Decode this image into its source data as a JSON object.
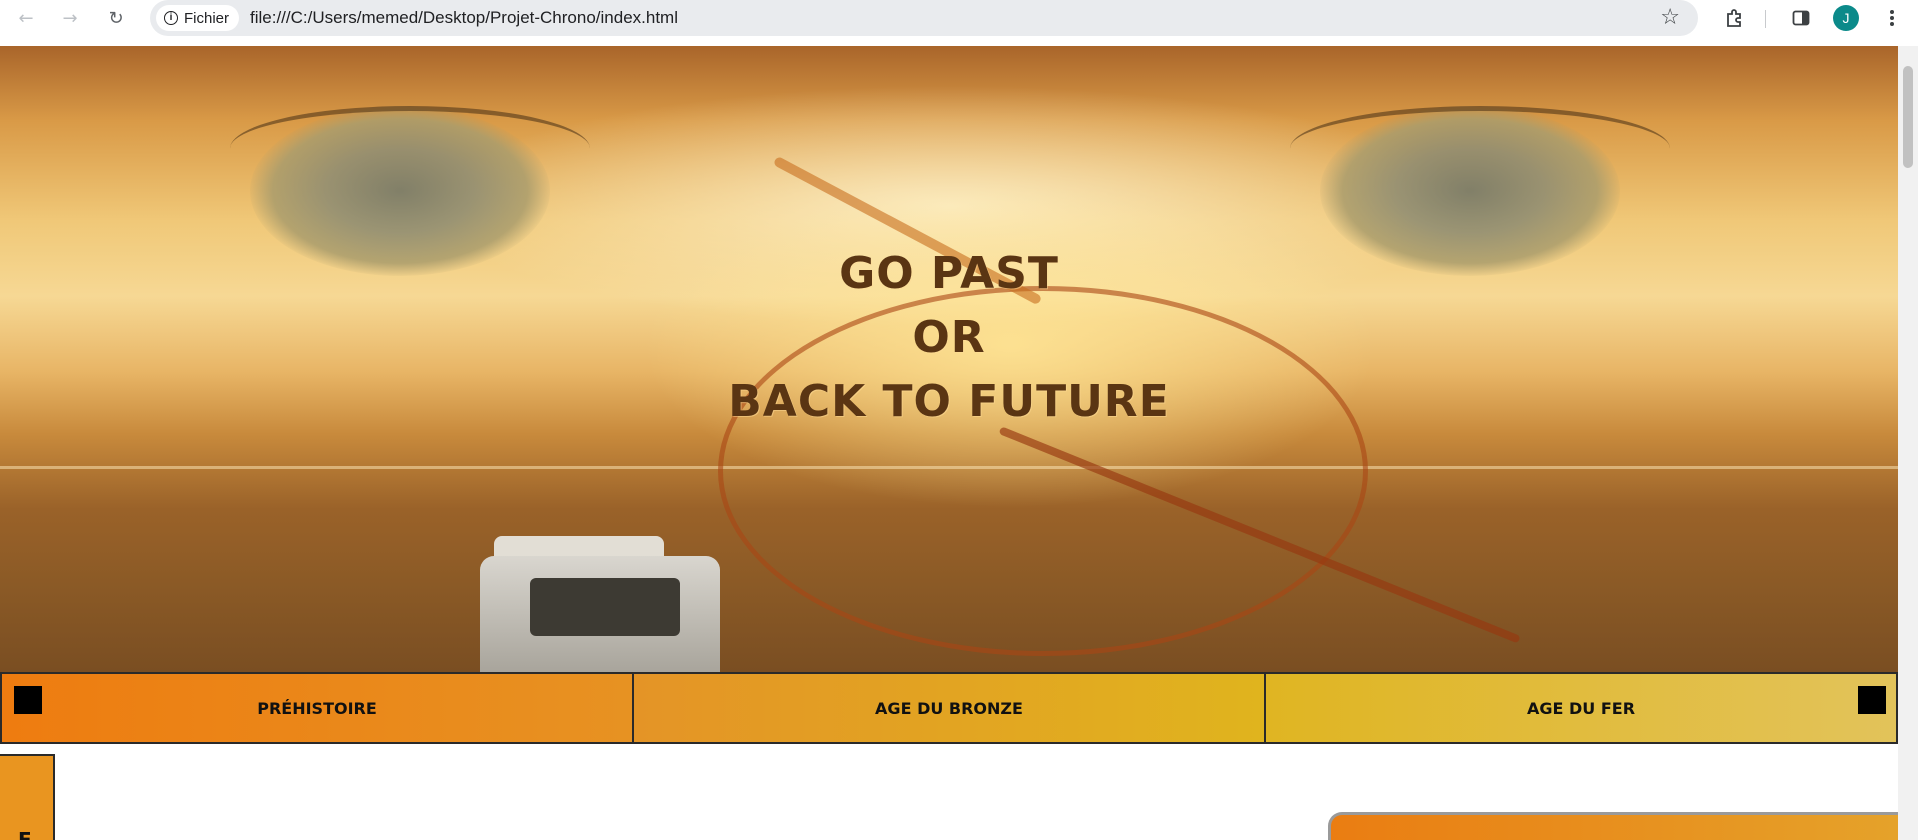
{
  "browser": {
    "site_chip_label": "Fichier",
    "url": "file:///C:/Users/memed/Desktop/Projet-Chrono/index.html",
    "avatar_initial": "J",
    "icons": [
      "back-icon",
      "forward-icon",
      "reload-icon",
      "info-icon",
      "star-icon",
      "extensions-icon",
      "side-panel-icon",
      "menu-icon"
    ]
  },
  "hero": {
    "line1": "GO PAST",
    "line2": "OR",
    "line3": "BACK TO FUTURE"
  },
  "periods": [
    {
      "label": "PRÉHISTOIRE"
    },
    {
      "label": "AGE DU BRONZE"
    },
    {
      "label": "AGE DU FER"
    }
  ],
  "side_tab": {
    "glyph": "E"
  },
  "colors": {
    "accent_orange": "#ee7c10",
    "accent_gold": "#e0b41e",
    "title_brown": "#5a3513"
  }
}
